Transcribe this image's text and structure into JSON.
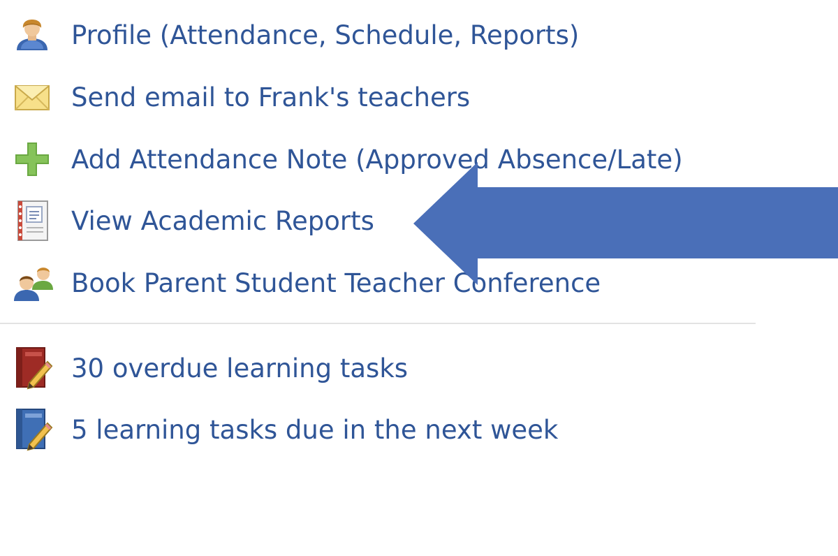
{
  "menu": {
    "links": [
      {
        "label": "Profile (Attendance, Schedule, Reports)",
        "icon": "user-icon"
      },
      {
        "label": "Send email to Frank's teachers",
        "icon": "envelope-icon"
      },
      {
        "label": "Add Attendance Note (Approved Absence/Late)",
        "icon": "plus-icon"
      },
      {
        "label": "View Academic Reports",
        "icon": "report-notebook-icon"
      },
      {
        "label": "Book Parent Student Teacher Conference",
        "icon": "people-icon"
      }
    ],
    "tasks": [
      {
        "label": "30 overdue learning tasks",
        "icon": "overdue-book-pencil-icon"
      },
      {
        "label": "5 learning tasks due in the next week",
        "icon": "upcoming-book-pencil-icon"
      }
    ]
  },
  "colors": {
    "link_text": "#2f5597",
    "arrow": "#4a6fb8",
    "divider": "#e2e2e2"
  }
}
